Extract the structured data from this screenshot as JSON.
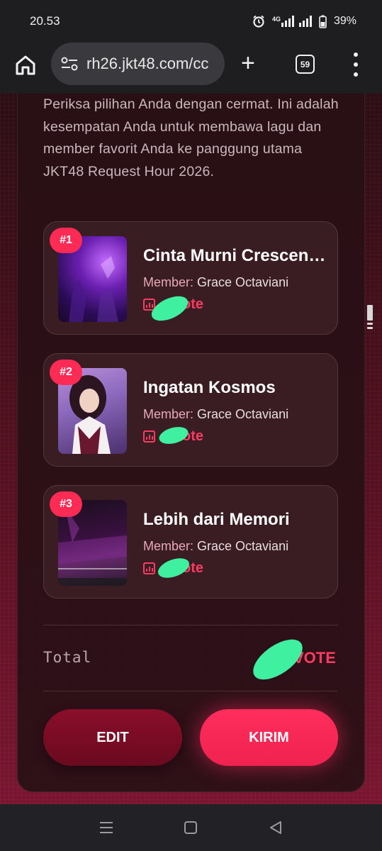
{
  "status_bar": {
    "time": "20.53",
    "network": "4G",
    "battery": "39%",
    "icons": [
      "alarm-icon",
      "signal-icon",
      "battery-icon"
    ]
  },
  "browser": {
    "url": "rh26.jkt48.com/cc",
    "tab_count": "59",
    "icons": [
      "home-icon",
      "site-settings-icon",
      "new-tab-icon",
      "tab-switcher-icon",
      "more-menu-icon"
    ]
  },
  "intro_text": "Periksa pilihan Anda dengan cermat. Ini adalah kesempatan Anda untuk membawa lagu dan member favorit Anda ke panggung utama JKT48 Request Hour 2026.",
  "selections": [
    {
      "rank": "#1",
      "title": "Cinta Murni Crescendo",
      "member_label": "Member:",
      "member": "Grace Octaviani",
      "vote_suffix": "ote"
    },
    {
      "rank": "#2",
      "title": "Ingatan Kosmos",
      "member_label": "Member:",
      "member": "Grace Octaviani",
      "vote_suffix": "ote"
    },
    {
      "rank": "#3",
      "title": "Lebih dari Memori",
      "member_label": "Member:",
      "member": "Grace Octaviani",
      "vote_suffix": "ote"
    }
  ],
  "total": {
    "label": "Total",
    "vote_suffix": "VOTE"
  },
  "actions": {
    "edit_label": "EDIT",
    "send_label": "KIRIM"
  },
  "colors": {
    "accent": "#ff2b55",
    "vote": "#ff3b63",
    "edit_button": "#7a0c25",
    "redaction": "#3ff0a0"
  }
}
